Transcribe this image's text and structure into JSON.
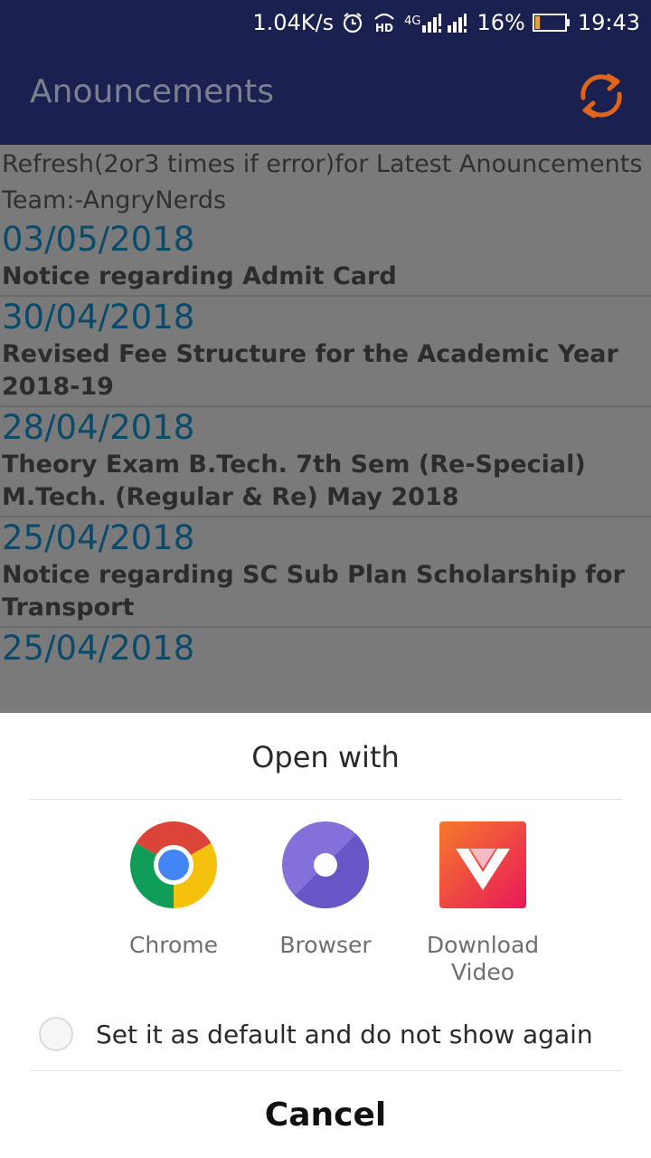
{
  "status_bar": {
    "network_speed": "1.04K/s",
    "hd_label": "HD",
    "network_type": "4G",
    "battery_percent": "16%",
    "battery_level": 0.16,
    "time": "19:43",
    "icons": [
      "alarm-icon",
      "hd-voice-icon",
      "signal-icon",
      "battery-icon"
    ]
  },
  "app_bar": {
    "title": "Anouncements",
    "refresh_icon": "refresh-icon",
    "accent_color": "#e0641c"
  },
  "content": {
    "info_text": "Refresh(2or3 times if error)for Latest Anouncements",
    "team_text": "Team:-AngryNerds",
    "announcements": [
      {
        "date": "03/05/2018",
        "title": " Notice regarding Admit Card"
      },
      {
        "date": "30/04/2018",
        "title": " Revised Fee Structure for the Academic Year 2018-19"
      },
      {
        "date": "28/04/2018",
        "title": " Theory Exam B.Tech. 7th Sem (Re-Special) M.Tech. (Regular & Re) May 2018"
      },
      {
        "date": "25/04/2018",
        "title": " Notice regarding SC Sub Plan Scholarship for Transport"
      },
      {
        "date": "25/04/2018",
        "title": ""
      }
    ]
  },
  "dialog": {
    "title": "Open with",
    "apps": [
      {
        "label": "Chrome",
        "icon": "chrome-icon"
      },
      {
        "label": "Browser",
        "icon": "browser-icon"
      },
      {
        "label": "Download Video",
        "icon": "download-video-icon"
      }
    ],
    "default_option": "Set it as default and do not show again",
    "cancel_label": "Cancel"
  }
}
